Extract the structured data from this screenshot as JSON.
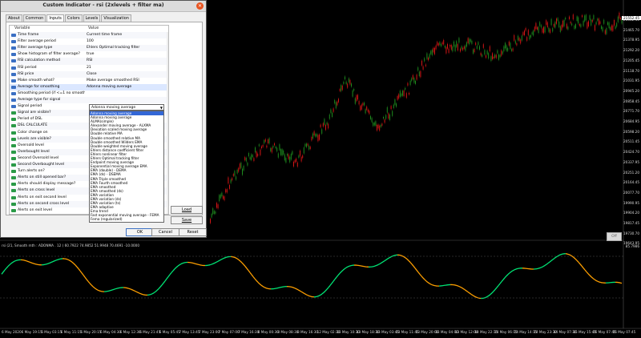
{
  "dialog": {
    "title": "Custom Indicator - rsi (2xlevels + filter ma)",
    "close_icon": "close-icon",
    "tabs": [
      "About",
      "Common",
      "Inputs",
      "Colors",
      "Levels",
      "Visualization"
    ],
    "active_tab": "Inputs",
    "columns": {
      "variable": "Variable",
      "value": "Value"
    },
    "rows": [
      {
        "label": "Time frame",
        "value": "Current time frame"
      },
      {
        "label": "Filter average period",
        "value": "100"
      },
      {
        "label": "Filter average type",
        "value": "Ehlers Optimal tracking filter"
      },
      {
        "label": "Show histogram of filter average?",
        "value": "true"
      },
      {
        "label": "RSI calculation method",
        "value": "RSI"
      },
      {
        "label": "RSI period",
        "value": "21"
      },
      {
        "label": "RSI price",
        "value": "Close"
      },
      {
        "label": "Make smooth what?",
        "value": "Make average smoothed RSI"
      },
      {
        "label": "Average for smoothing",
        "value": "Adonna moving average"
      },
      {
        "label": "Smoothing period (if <=1 no smooth...",
        "value": ""
      },
      {
        "label": "Average type for signal",
        "value": ""
      },
      {
        "label": "Signal period",
        "value": ""
      },
      {
        "label": "Signal are visible?",
        "value": ""
      },
      {
        "label": "Period of DSL",
        "value": ""
      },
      {
        "label": "DSL CALCULATE",
        "value": ""
      },
      {
        "label": "Color change on",
        "value": ""
      },
      {
        "label": "Levels are visible?",
        "value": ""
      },
      {
        "label": "Oversold level",
        "value": ""
      },
      {
        "label": "Overbought level",
        "value": ""
      },
      {
        "label": "Second Oversold level",
        "value": ""
      },
      {
        "label": "Second Overbought level",
        "value": ""
      },
      {
        "label": "Turn alerts on?",
        "value": ""
      },
      {
        "label": "Alerts on still opened bar?",
        "value": ""
      },
      {
        "label": "Alerts should display message?",
        "value": ""
      },
      {
        "label": "Alerts on  cross level",
        "value": ""
      },
      {
        "label": "Alerts on exit second level",
        "value": ""
      },
      {
        "label": "Alerts on second cross level",
        "value": ""
      },
      {
        "label": "Alerts on exit level",
        "value": ""
      },
      {
        "label": "Alerts should send email?",
        "value": ""
      }
    ],
    "selected_row_index": 8,
    "combo_value": "Adonna moving average",
    "dropdown_options": [
      "Adonna moving average",
      "Adonna moving average",
      "ALMA(simple)",
      "Alexander moving average - ALXMA",
      "Deviation scaled moving average",
      "Double relative MA",
      "Double smoothed relative MA",
      "Double smoothed Wilders EMA",
      "Double weighted moving average",
      "Ehlers distance coefficient filter",
      "Ehlers nonlinear filter",
      "Ehlers Optimal tracking filter",
      "Endpoint moving average",
      "Exponential moving average EMA",
      "EMA (double) - DEMA",
      "EMA (ds) - DSEMA",
      "EMA Triple smoothed",
      "EMA Fourth smoothed",
      "EMA smoothed",
      "EMA smoothed (ds)",
      "EMA variation",
      "EMA variation (ds)",
      "EMA variation (ts)",
      "EMA adaptive",
      "Ema trend",
      "Fast exponential moving average - FEMA",
      "Fema (regularized)",
      "FEMA (double) - DFEMA",
      "FEMA (ds) DSFEMA",
      "FEMA Triple smoothed"
    ],
    "selected_option_index": 0,
    "buttons": {
      "load": "Load",
      "save": "Save",
      "ok": "OK",
      "cancel": "Cancel",
      "reset": "Reset"
    }
  },
  "chart": {
    "price_labels": [
      "21552.45",
      "21465.70",
      "21378.95",
      "21292.20",
      "21205.45",
      "21118.70",
      "21031.95",
      "20945.20",
      "20858.45",
      "20771.70",
      "20684.95",
      "20598.20",
      "20511.45",
      "20424.70",
      "20337.95",
      "20251.20",
      "20164.45",
      "20077.70",
      "19990.95",
      "19904.20",
      "19817.45",
      "19730.70",
      "19643.95"
    ],
    "current_price": "21552.45",
    "off_button": "Off",
    "oscillator_title": "rsi (21, Smooth mth : ADONMA . 12 ) 60.7922 74.9852 51.9948 70.4691 -10.0000",
    "oscillator_level": "85.7986",
    "time_labels": [
      "6 May 2020",
      "6 May 19:15",
      "6 May 03:15",
      "6 May 11:15",
      "6 May 20:15",
      "6 May 04:30",
      "6 May 12:30",
      "6 May 21:45",
      "6 May 05:45",
      "7 May 13:45",
      "7 May 23:00",
      "7 May 07:00",
      "7 May 16:30",
      "8 May 00:30",
      "8 May 08:30",
      "8 May 16:30",
      "12 May 02:30",
      "13 May 10:30",
      "13 May 18:30",
      "13 May 03:45",
      "13 May 11:45",
      "13 May 20:00",
      "13 May 04:00",
      "13 May 12:00",
      "14 May 22:15",
      "14 May 06:15",
      "14 May 14:15",
      "14 May 23:30",
      "14 May 07:30",
      "15 May 15:45",
      "16 May 07:45",
      "16 May 07:45"
    ],
    "colors": {
      "bull": "#1e8c1e",
      "bear": "#d41616",
      "osc_up": "#00e676",
      "osc_down": "#ffa000"
    }
  }
}
